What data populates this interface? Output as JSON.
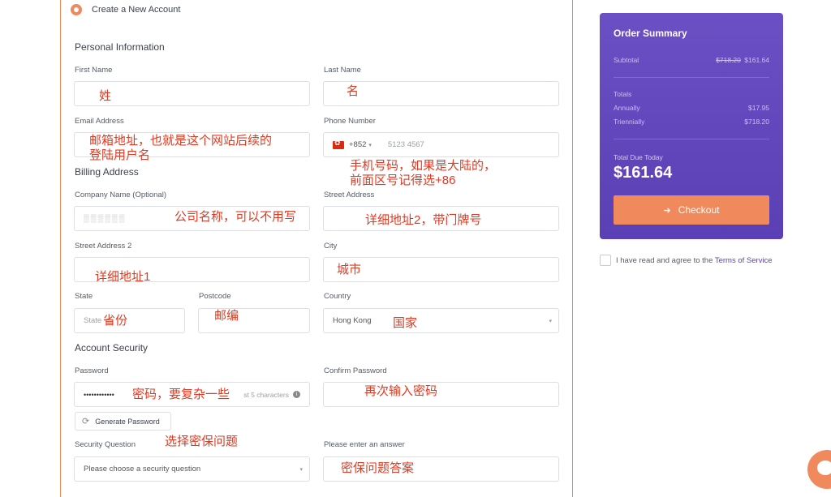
{
  "account": {
    "option_label": "Create a New Account"
  },
  "personal": {
    "title": "Personal Information",
    "first_name_label": "First Name",
    "last_name_label": "Last Name",
    "email_label": "Email Address",
    "phone_label": "Phone Number",
    "phone_code": "+852",
    "phone_placeholder": "5123 4567"
  },
  "billing": {
    "title": "Billing Address",
    "company_label": "Company Name (Optional)",
    "street_label": "Street Address",
    "street2_label": "Street Address 2",
    "city_label": "City",
    "state_label": "State",
    "state_placeholder": "State",
    "postcode_label": "Postcode",
    "country_label": "Country",
    "country_value": "Hong Kong"
  },
  "security": {
    "title": "Account Security",
    "password_label": "Password",
    "password_value": "••••••••••••",
    "password_hint": "st 5 characters",
    "confirm_label": "Confirm Password",
    "generate_label": "Generate Password",
    "question_label": "Security Question",
    "question_placeholder": "Please choose a security question",
    "answer_label": "Please enter an answer"
  },
  "annotations": {
    "first_name": "姓",
    "last_name": "名",
    "email_line1": "邮箱地址，也就是这个网站后续的",
    "email_line2": "登陆用户名",
    "phone_line1": "手机号码，如果是大陆的，",
    "phone_line2": "前面区号记得选+86",
    "company": "公司名称，可以不用写",
    "street": "详细地址2，带门牌号",
    "street2": "详细地址1",
    "city": "城市",
    "state": "省份",
    "postcode": "邮编",
    "country": "国家",
    "password": "密码，要复杂一些",
    "confirm": "再次输入密码",
    "question": "选择密保问题",
    "answer": "密保问题答案"
  },
  "summary": {
    "title": "Order Summary",
    "subtotal_label": "Subtotal",
    "subtotal_old": "$718.20",
    "subtotal_new": "$161.64",
    "totals_label": "Totals",
    "annually_label": "Annually",
    "annually_value": "$17.95",
    "triennially_label": "Triennially",
    "triennially_value": "$718.20",
    "due_label": "Total Due Today",
    "due_amount": "$161.64",
    "checkout_label": "Checkout"
  },
  "tos": {
    "text": "I have read and agree to the ",
    "link": "Terms of Service"
  },
  "colors": {
    "accent": "#f08a5d",
    "summary_bg": "#5a3fb5",
    "annotation": "#e03a22"
  }
}
